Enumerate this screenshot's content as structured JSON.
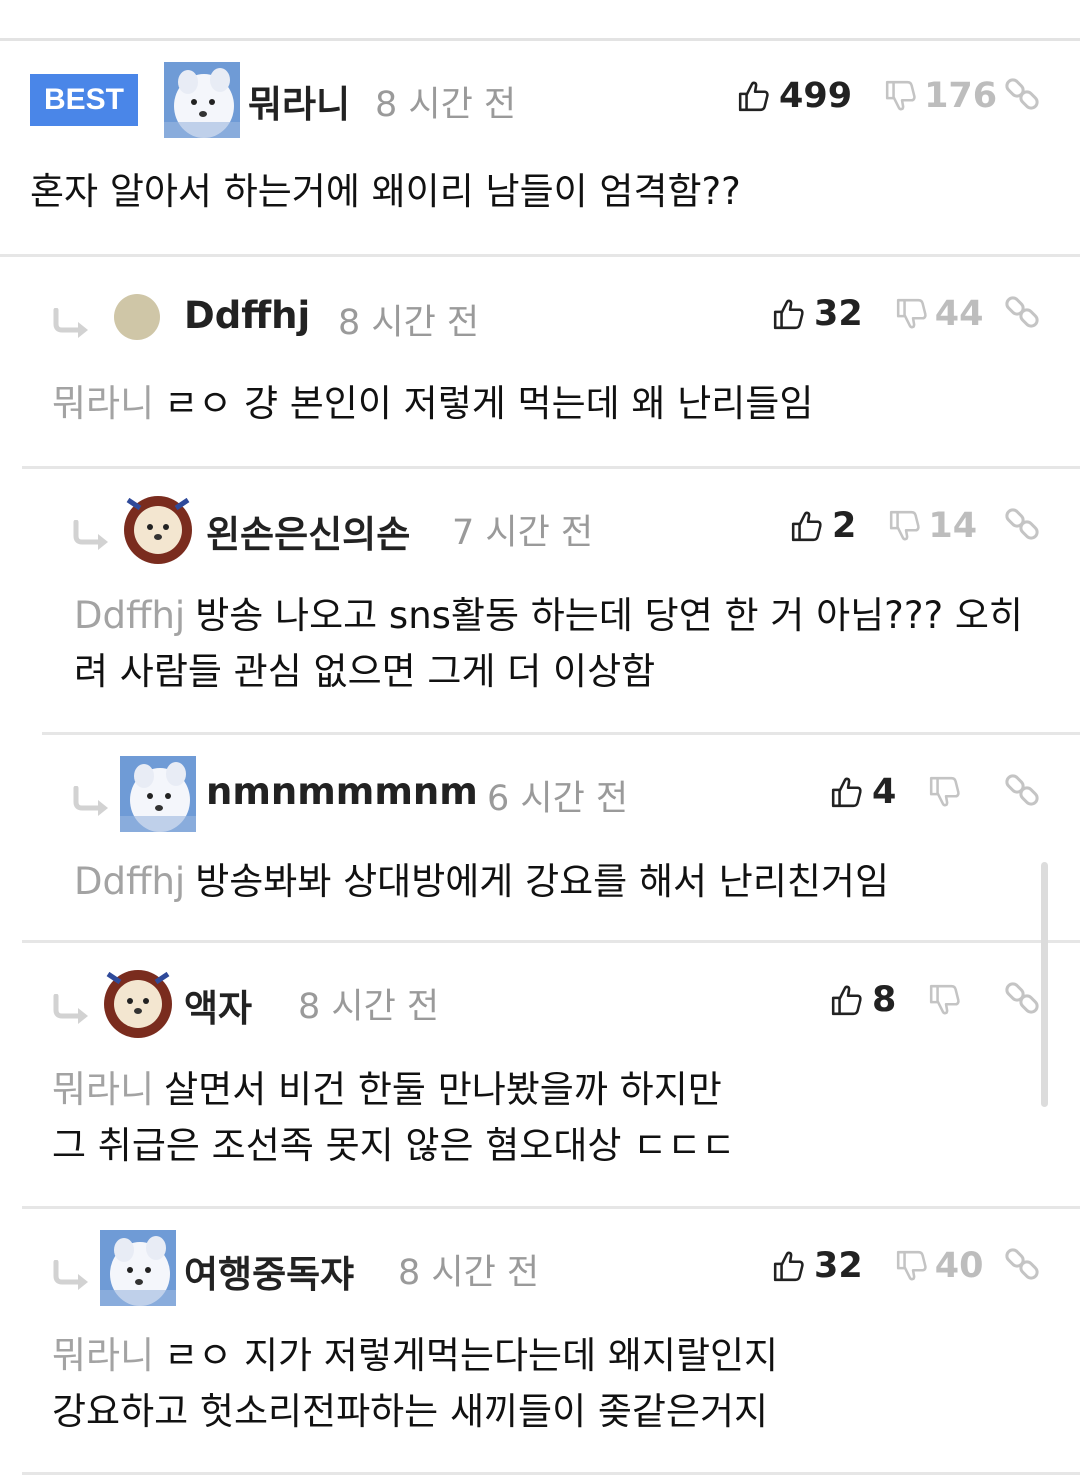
{
  "colors": {
    "best_badge": "#4a86e8",
    "time": "#9a9a9a",
    "mention": "#a3a3a3",
    "down_count": "#bdbdbd"
  },
  "comments": [
    {
      "badge": "BEST",
      "author": "뭐라니",
      "time": "8 시간 전",
      "likes": "499",
      "dislikes": "176",
      "mention": "",
      "lines": [
        "혼자 알아서 하는거에 왜이리 남들이 엄격함??"
      ],
      "avatar": "white-dog-avatar"
    },
    {
      "author": "Ddffhj",
      "time": "8 시간 전",
      "likes": "32",
      "dislikes": "44",
      "mention": "뭐라니",
      "lines": [
        "ㄹㅇ 걍 본인이 저렇게 먹는데 왜 난리들임"
      ],
      "avatar": "default-avatar"
    },
    {
      "author": "왼손은신의손",
      "time": "7 시간 전",
      "likes": "2",
      "dislikes": "14",
      "mention": "Ddffhj",
      "lines": [
        "방송 나오고 sns활동 하는데 당연 한 거 아님??? 오히",
        "려 사람들 관심 없으면 그게 더 이상함"
      ],
      "avatar": "lion-dog-avatar"
    },
    {
      "author": "nmnmmmnm",
      "time": "6 시간 전",
      "likes": "4",
      "dislikes": "",
      "mention": "Ddffhj",
      "lines": [
        "방송봐봐 상대방에게 강요를 해서 난리친거임"
      ],
      "avatar": "white-dog-avatar"
    },
    {
      "author": "액자",
      "time": "8 시간 전",
      "likes": "8",
      "dislikes": "",
      "mention": "뭐라니",
      "lines": [
        "살면서 비건 한둘 만나봤을까 하지만",
        "그 취급은 조선족 못지 않은 혐오대상 ㄷㄷㄷ"
      ],
      "avatar": "lion-dog-avatar"
    },
    {
      "author": "여행중독쟈",
      "time": "8 시간 전",
      "likes": "32",
      "dislikes": "40",
      "mention": "뭐라니",
      "lines": [
        "ㄹㅇ 지가 저렇게먹는다는데 왜지랄인지",
        "강요하고 헛소리전파하는 새끼들이 좆같은거지"
      ],
      "avatar": "white-dog-avatar"
    }
  ]
}
